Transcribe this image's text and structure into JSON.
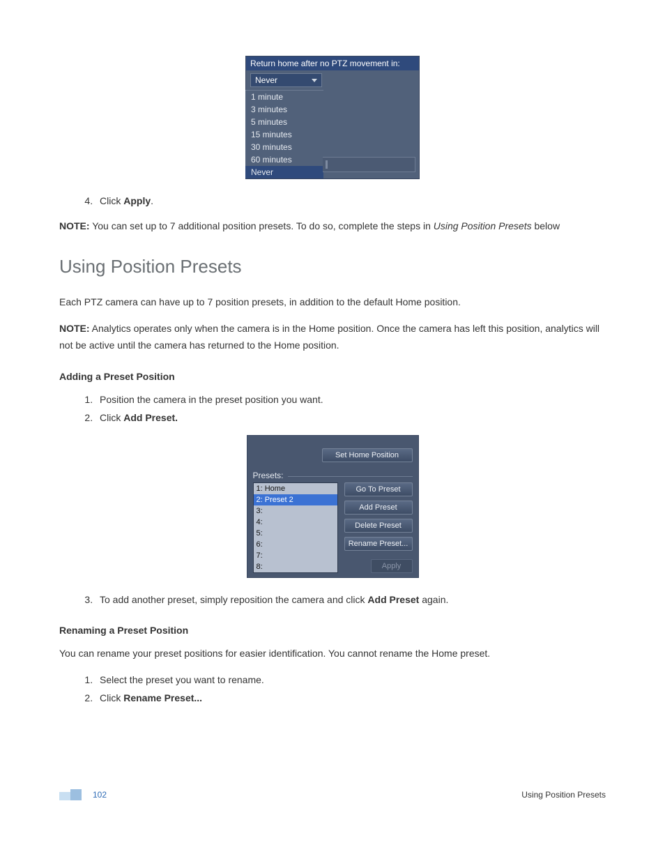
{
  "figure1": {
    "title": "Return home after no PTZ movement in:",
    "selected": "Never",
    "options": [
      "1 minute",
      "3 minutes",
      "5 minutes",
      "15 minutes",
      "30 minutes",
      "60 minutes",
      "Never"
    ],
    "highlight_index": 6
  },
  "step4": {
    "prefix": "Click ",
    "bold": "Apply",
    "suffix": "."
  },
  "note1": {
    "label": "NOTE:",
    "text_before_italic": " You can set up to 7 additional position presets. To do so, complete the steps in ",
    "italic": "Using Position Presets",
    "text_after_italic": " below"
  },
  "heading": "Using Position Presets",
  "para_intro": "Each PTZ camera can have up to 7 position presets, in addition to the default Home position.",
  "note2": {
    "label": "NOTE:",
    "text": " Analytics operates only when the camera is in the Home position. Once the camera has left this position, analytics will not be active until the camera has returned to the Home position."
  },
  "sub_adding": "Adding a Preset Position",
  "adding_steps": {
    "s1": "Position the camera in the preset position you want.",
    "s2_prefix": "Click ",
    "s2_bold": "Add Preset."
  },
  "figure2": {
    "set_home": "Set Home Position",
    "legend": "Presets:",
    "items": [
      "1: Home",
      "2: Preset 2",
      "3:",
      "4:",
      "5:",
      "6:",
      "7:",
      "8:"
    ],
    "selected_index": 1,
    "buttons": {
      "goto": "Go To Preset",
      "add": "Add Preset",
      "del": "Delete Preset",
      "rename": "Rename Preset...",
      "apply": "Apply"
    }
  },
  "step3": {
    "prefix": "To add another preset, simply reposition the camera and click ",
    "bold": "Add Preset",
    "suffix": " again."
  },
  "sub_renaming": "Renaming a Preset Position",
  "para_rename": "You can rename your preset positions for easier identification. You cannot rename the Home preset.",
  "rename_steps": {
    "s1": "Select the preset you want to rename.",
    "s2_prefix": "Click ",
    "s2_bold": "Rename Preset..."
  },
  "footer": {
    "page": "102",
    "title": "Using Position Presets"
  }
}
